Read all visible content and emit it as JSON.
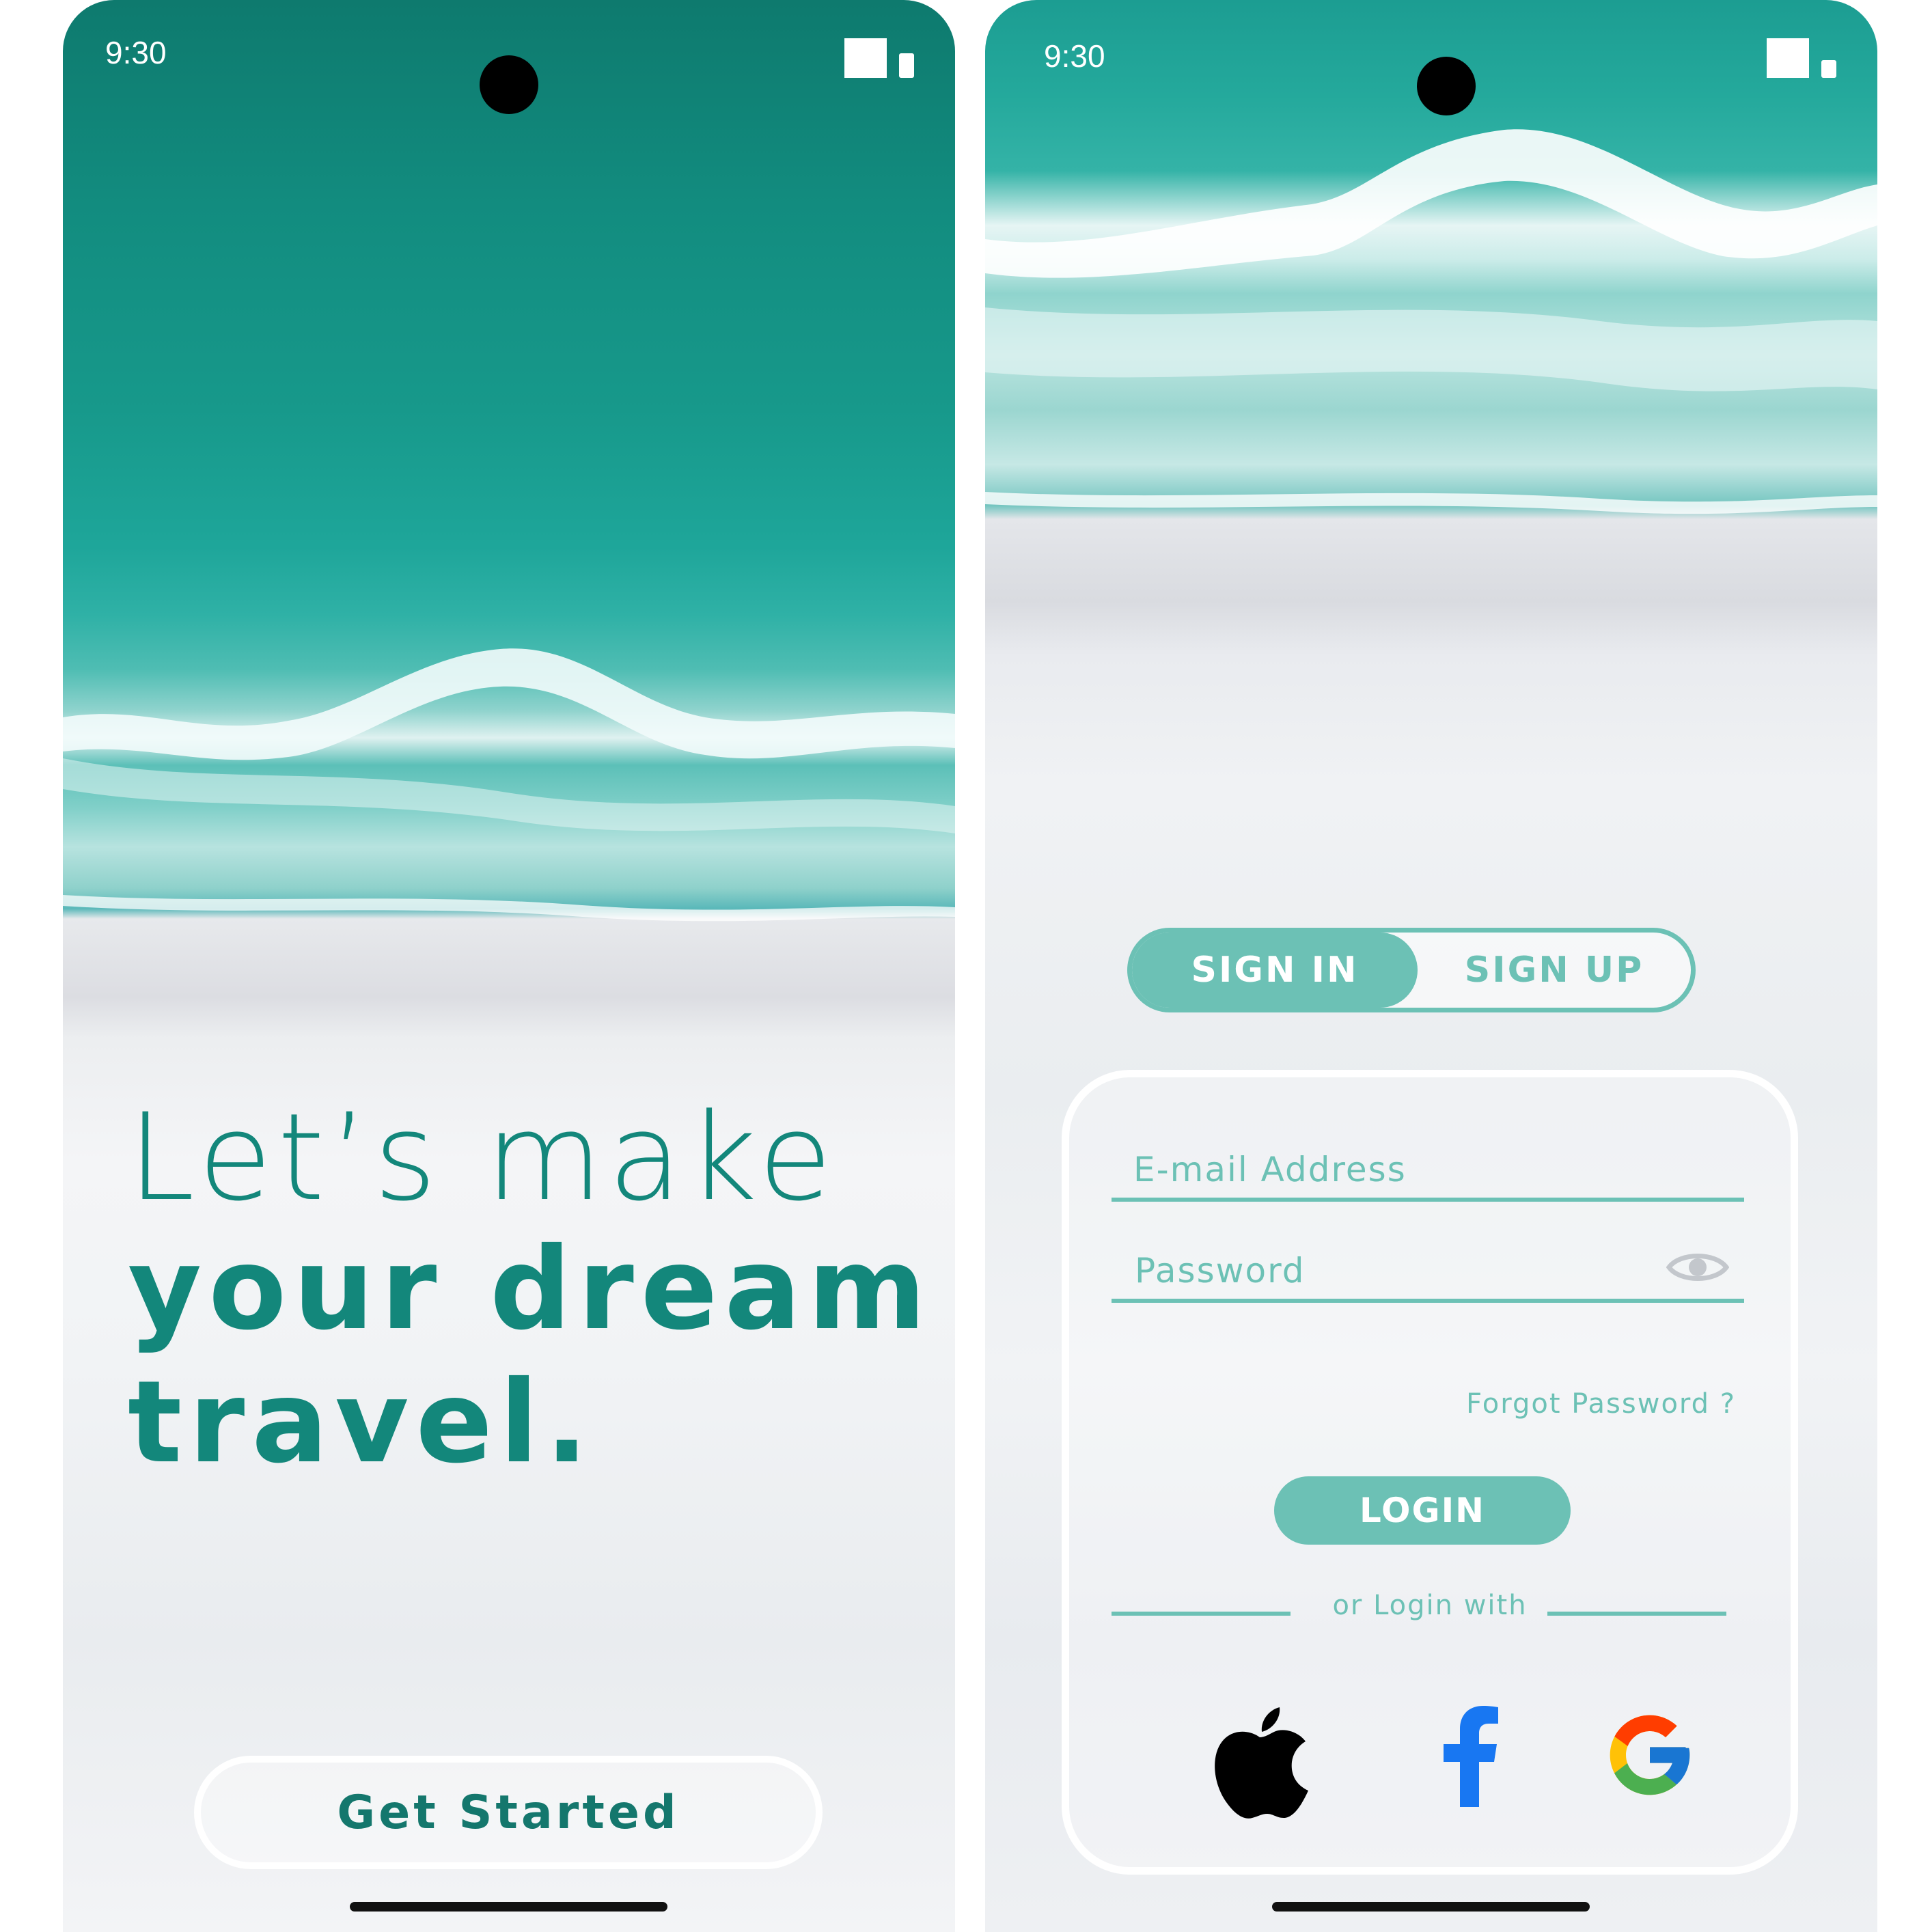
{
  "status": {
    "time": "9:30"
  },
  "welcome": {
    "headline_line1": "Let’s make",
    "headline_line2": "your dream",
    "headline_line3": "travel.",
    "cta_label": "Get Started"
  },
  "auth": {
    "tabs": [
      {
        "label": "SIGN IN",
        "active": true
      },
      {
        "label": "SIGN UP",
        "active": false
      }
    ],
    "email_placeholder": "E-mail Address",
    "password_placeholder": "Password",
    "forgot_label": "Forgot Password ?",
    "login_label": "LOGIN",
    "divider_text": "or Login with",
    "social": [
      "apple-icon",
      "facebook-icon",
      "google-icon"
    ]
  },
  "colors": {
    "accent": "#6cc1b5",
    "headline": "#13877b"
  }
}
